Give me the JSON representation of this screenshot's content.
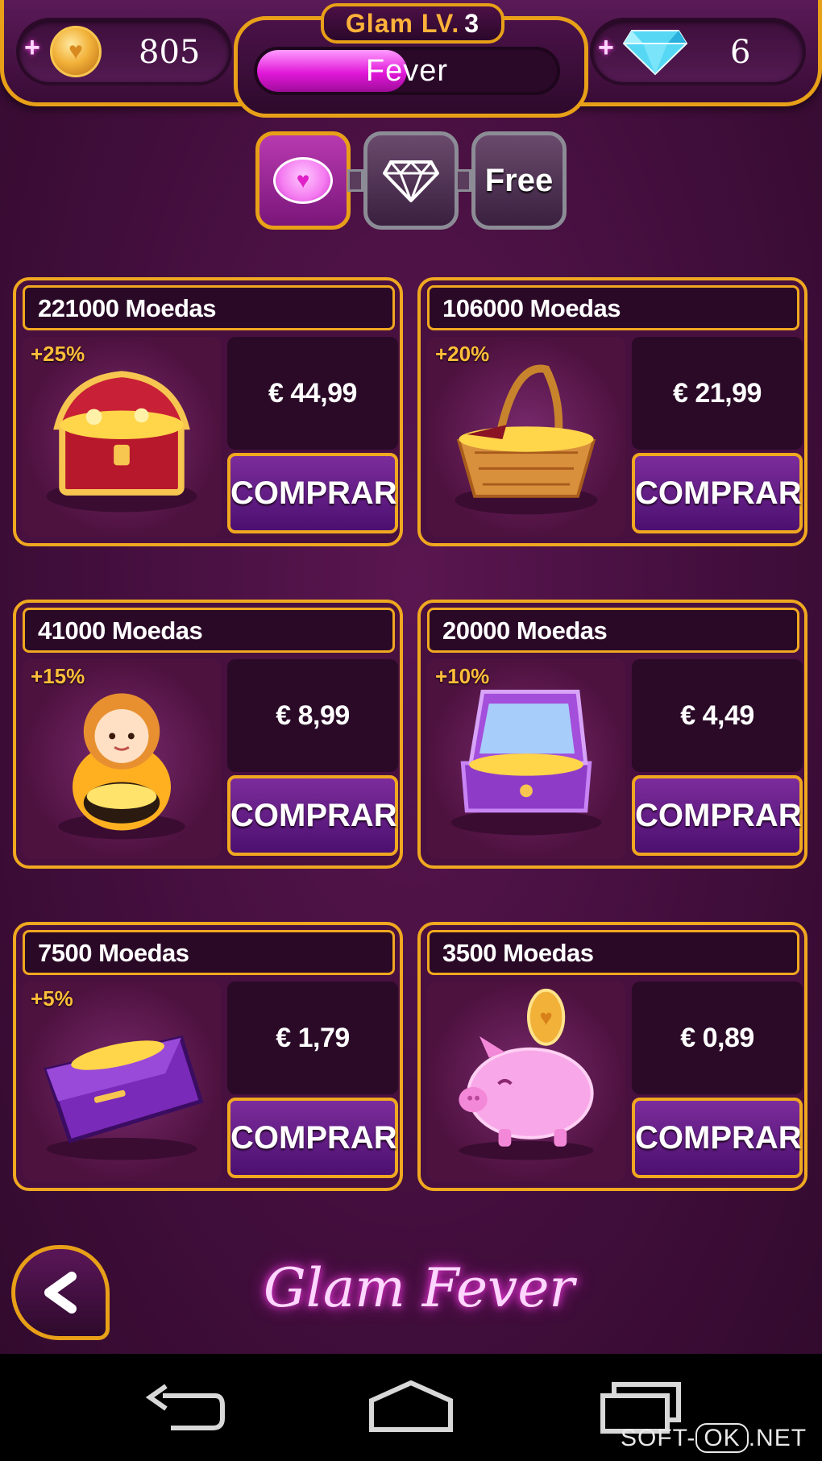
{
  "hud": {
    "coins": "805",
    "gems": "6",
    "level_label": "Glam LV.",
    "level_value": "3",
    "xp_label": "Fever",
    "xp_progress": 0.5
  },
  "tabs": [
    {
      "id": "coins",
      "icon": "heart-coin-icon",
      "active": true
    },
    {
      "id": "gems",
      "icon": "diamond-icon",
      "active": false
    },
    {
      "id": "free",
      "label": "Free",
      "active": false
    }
  ],
  "offers": [
    {
      "title": "221000 Moedas",
      "bonus": "+25%",
      "price": "€ 44,99",
      "button": "COMPRAR",
      "item": "treasure-chest"
    },
    {
      "title": "106000 Moedas",
      "bonus": "+20%",
      "price": "€ 21,99",
      "button": "COMPRAR",
      "item": "basket"
    },
    {
      "title": "41000 Moedas",
      "bonus": "+15%",
      "price": "€ 8,99",
      "button": "COMPRAR",
      "item": "doll"
    },
    {
      "title": "20000 Moedas",
      "bonus": "+10%",
      "price": "€ 4,49",
      "button": "COMPRAR",
      "item": "jewelry-box"
    },
    {
      "title": "7500 Moedas",
      "bonus": "+5%",
      "price": "€ 1,79",
      "button": "COMPRAR",
      "item": "purse"
    },
    {
      "title": "3500 Moedas",
      "bonus": "",
      "price": "€ 0,89",
      "button": "COMPRAR",
      "item": "piggy-bank"
    }
  ],
  "logo": "Glam Fever",
  "watermark": {
    "a": "SOFT-",
    "b": "OK",
    "c": ".NET"
  },
  "colors": {
    "accent": "#e8a018",
    "bg": "#420e3c",
    "button": "#6a2090",
    "bonus": "#ffbd3a"
  }
}
